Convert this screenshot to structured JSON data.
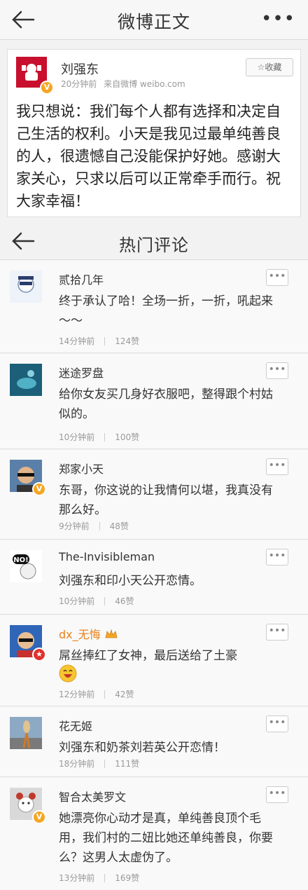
{
  "header": {
    "title": "微博正文",
    "more": "•••"
  },
  "post": {
    "author": "刘强东",
    "time": "20分钟前",
    "source": "来自微博 weibo.com",
    "fav_label": "收藏",
    "text": "我只想说：我们每个人都有选择和决定自己生活的权利。小天是我见过最单纯善良的人，很遗憾自己没能保护好她。感谢大家关心，只求以后可以正常牵手而行。祝大家幸福！"
  },
  "hot": {
    "title": "热门评论"
  },
  "comments": [
    {
      "name": "贰拾几年",
      "text": "终于承认了哈！全场一折，一折，吼起来～～",
      "time": "14分钟前",
      "likes": "124赞",
      "more": "•••"
    },
    {
      "name": "迷途罗盘",
      "text": "给你女友买几身好衣服吧，整得跟个村姑似的。",
      "time": "10分钟前",
      "likes": "100赞",
      "more": "•••"
    },
    {
      "name": "郑家小天",
      "text": "东哥，你这说的让我情何以堪，我真没有那么好。",
      "time": "9分钟前",
      "likes": "48赞",
      "more": "•••"
    },
    {
      "name": "The-Invisibleman",
      "text": "刘强东和印小天公开恋情。",
      "time": "10分钟前",
      "likes": "46赞",
      "more": "•••"
    },
    {
      "name": "dx_无悔",
      "text": "屌丝捧红了女神，最后送给了土豪",
      "time": "12分钟前",
      "likes": "42赞",
      "more": "•••"
    },
    {
      "name": "花无姬",
      "text": "刘强东和奶茶刘若英公开恋情！",
      "time": "18分钟前",
      "likes": "111赞",
      "more": "•••"
    },
    {
      "name": "智合太美罗文",
      "text": "她漂亮你心动才是真，单纯善良顶个毛用，我们村的二妞比她还单纯善良，你要么？这男人太虚伪了。",
      "time": "13分钟前",
      "likes": "169赞",
      "more": "•••"
    }
  ],
  "colors": {
    "vip_name": "#e8821b",
    "verified_badge": "#f5a623",
    "brand_red": "#c8102e"
  }
}
